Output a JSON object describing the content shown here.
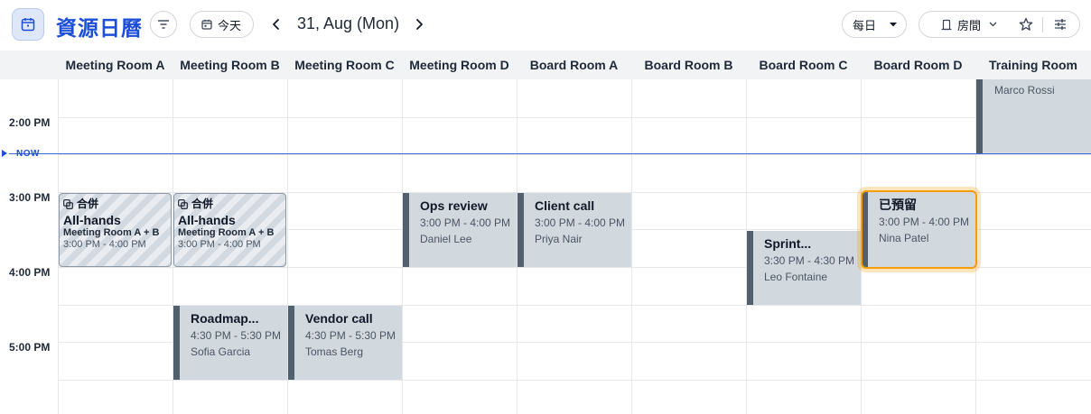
{
  "app": {
    "title": "資源日曆"
  },
  "toolbar": {
    "today_label": "今天",
    "date_label": "31, Aug (Mon)",
    "view_label": "每日",
    "room_filter_label": "房間"
  },
  "rooms": [
    "Meeting Room A",
    "Meeting Room B",
    "Meeting Room C",
    "Meeting Room D",
    "Board Room A",
    "Board Room B",
    "Board Room C",
    "Board Room D",
    "Training Room"
  ],
  "times": [
    "2:00 PM",
    "3:00 PM",
    "4:00 PM",
    "5:00 PM"
  ],
  "now_label": "NOW",
  "events": {
    "training_room": {
      "person": "Marco Rossi"
    },
    "all_hands_a": {
      "tag": "合併",
      "title": "All-hands",
      "rooms": "Meeting Room A + B",
      "time": "3:00 PM - 4:00 PM"
    },
    "all_hands_b": {
      "tag": "合併",
      "title": "All-hands",
      "rooms": "Meeting Room A + B",
      "time": "3:00 PM - 4:00 PM"
    },
    "ops_review": {
      "title": "Ops review",
      "time": "3:00 PM - 4:00 PM",
      "person": "Daniel Lee"
    },
    "client_call": {
      "title": "Client call",
      "time": "3:00 PM - 4:00 PM",
      "person": "Priya Nair"
    },
    "sprint": {
      "title": "Sprint...",
      "time": "3:30 PM - 4:30 PM",
      "person": "Leo Fontaine"
    },
    "reserved": {
      "title": "已預留",
      "time": "3:00 PM - 4:00 PM",
      "person": "Nina Patel"
    },
    "roadmap": {
      "title": "Roadmap...",
      "time": "4:30 PM - 5:30 PM",
      "person": "Sofia Garcia"
    },
    "vendor_call": {
      "title": "Vendor call",
      "time": "4:30 PM - 5:30 PM",
      "person": "Tomas Berg"
    }
  },
  "colors": {
    "accent": "#1d4ed8",
    "event_bg": "#d1d8de",
    "event_bar": "#52606d",
    "selected": "#f59e0b"
  }
}
